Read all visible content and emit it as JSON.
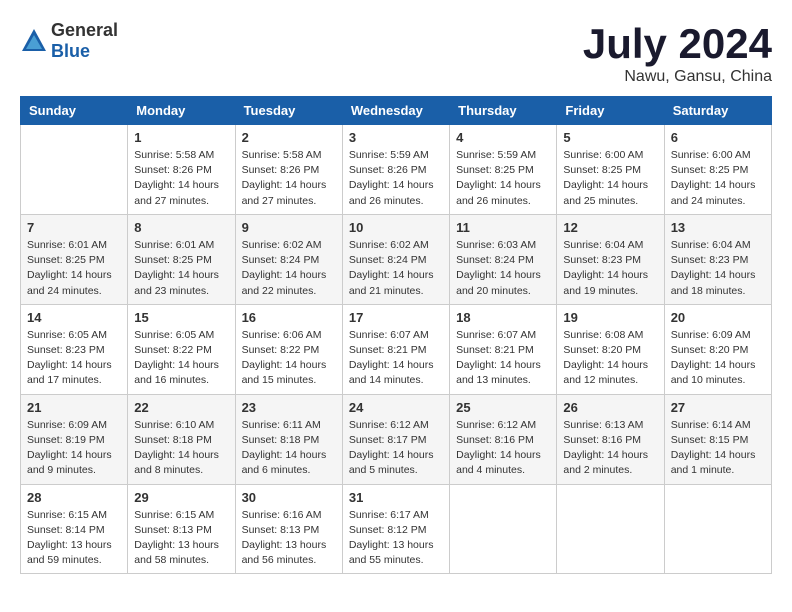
{
  "header": {
    "logo_general": "General",
    "logo_blue": "Blue",
    "month_title": "July 2024",
    "subtitle": "Nawu, Gansu, China"
  },
  "days": [
    "Sunday",
    "Monday",
    "Tuesday",
    "Wednesday",
    "Thursday",
    "Friday",
    "Saturday"
  ],
  "weeks": [
    [
      {
        "date": "",
        "content": ""
      },
      {
        "date": "1",
        "content": "Sunrise: 5:58 AM\nSunset: 8:26 PM\nDaylight: 14 hours and 27 minutes."
      },
      {
        "date": "2",
        "content": "Sunrise: 5:58 AM\nSunset: 8:26 PM\nDaylight: 14 hours and 27 minutes."
      },
      {
        "date": "3",
        "content": "Sunrise: 5:59 AM\nSunset: 8:26 PM\nDaylight: 14 hours and 26 minutes."
      },
      {
        "date": "4",
        "content": "Sunrise: 5:59 AM\nSunset: 8:25 PM\nDaylight: 14 hours and 26 minutes."
      },
      {
        "date": "5",
        "content": "Sunrise: 6:00 AM\nSunset: 8:25 PM\nDaylight: 14 hours and 25 minutes."
      },
      {
        "date": "6",
        "content": "Sunrise: 6:00 AM\nSunset: 8:25 PM\nDaylight: 14 hours and 24 minutes."
      }
    ],
    [
      {
        "date": "7",
        "content": "Sunrise: 6:01 AM\nSunset: 8:25 PM\nDaylight: 14 hours and 24 minutes."
      },
      {
        "date": "8",
        "content": "Sunrise: 6:01 AM\nSunset: 8:25 PM\nDaylight: 14 hours and 23 minutes."
      },
      {
        "date": "9",
        "content": "Sunrise: 6:02 AM\nSunset: 8:24 PM\nDaylight: 14 hours and 22 minutes."
      },
      {
        "date": "10",
        "content": "Sunrise: 6:02 AM\nSunset: 8:24 PM\nDaylight: 14 hours and 21 minutes."
      },
      {
        "date": "11",
        "content": "Sunrise: 6:03 AM\nSunset: 8:24 PM\nDaylight: 14 hours and 20 minutes."
      },
      {
        "date": "12",
        "content": "Sunrise: 6:04 AM\nSunset: 8:23 PM\nDaylight: 14 hours and 19 minutes."
      },
      {
        "date": "13",
        "content": "Sunrise: 6:04 AM\nSunset: 8:23 PM\nDaylight: 14 hours and 18 minutes."
      }
    ],
    [
      {
        "date": "14",
        "content": "Sunrise: 6:05 AM\nSunset: 8:23 PM\nDaylight: 14 hours and 17 minutes."
      },
      {
        "date": "15",
        "content": "Sunrise: 6:05 AM\nSunset: 8:22 PM\nDaylight: 14 hours and 16 minutes."
      },
      {
        "date": "16",
        "content": "Sunrise: 6:06 AM\nSunset: 8:22 PM\nDaylight: 14 hours and 15 minutes."
      },
      {
        "date": "17",
        "content": "Sunrise: 6:07 AM\nSunset: 8:21 PM\nDaylight: 14 hours and 14 minutes."
      },
      {
        "date": "18",
        "content": "Sunrise: 6:07 AM\nSunset: 8:21 PM\nDaylight: 14 hours and 13 minutes."
      },
      {
        "date": "19",
        "content": "Sunrise: 6:08 AM\nSunset: 8:20 PM\nDaylight: 14 hours and 12 minutes."
      },
      {
        "date": "20",
        "content": "Sunrise: 6:09 AM\nSunset: 8:20 PM\nDaylight: 14 hours and 10 minutes."
      }
    ],
    [
      {
        "date": "21",
        "content": "Sunrise: 6:09 AM\nSunset: 8:19 PM\nDaylight: 14 hours and 9 minutes."
      },
      {
        "date": "22",
        "content": "Sunrise: 6:10 AM\nSunset: 8:18 PM\nDaylight: 14 hours and 8 minutes."
      },
      {
        "date": "23",
        "content": "Sunrise: 6:11 AM\nSunset: 8:18 PM\nDaylight: 14 hours and 6 minutes."
      },
      {
        "date": "24",
        "content": "Sunrise: 6:12 AM\nSunset: 8:17 PM\nDaylight: 14 hours and 5 minutes."
      },
      {
        "date": "25",
        "content": "Sunrise: 6:12 AM\nSunset: 8:16 PM\nDaylight: 14 hours and 4 minutes."
      },
      {
        "date": "26",
        "content": "Sunrise: 6:13 AM\nSunset: 8:16 PM\nDaylight: 14 hours and 2 minutes."
      },
      {
        "date": "27",
        "content": "Sunrise: 6:14 AM\nSunset: 8:15 PM\nDaylight: 14 hours and 1 minute."
      }
    ],
    [
      {
        "date": "28",
        "content": "Sunrise: 6:15 AM\nSunset: 8:14 PM\nDaylight: 13 hours and 59 minutes."
      },
      {
        "date": "29",
        "content": "Sunrise: 6:15 AM\nSunset: 8:13 PM\nDaylight: 13 hours and 58 minutes."
      },
      {
        "date": "30",
        "content": "Sunrise: 6:16 AM\nSunset: 8:13 PM\nDaylight: 13 hours and 56 minutes."
      },
      {
        "date": "31",
        "content": "Sunrise: 6:17 AM\nSunset: 8:12 PM\nDaylight: 13 hours and 55 minutes."
      },
      {
        "date": "",
        "content": ""
      },
      {
        "date": "",
        "content": ""
      },
      {
        "date": "",
        "content": ""
      }
    ]
  ]
}
